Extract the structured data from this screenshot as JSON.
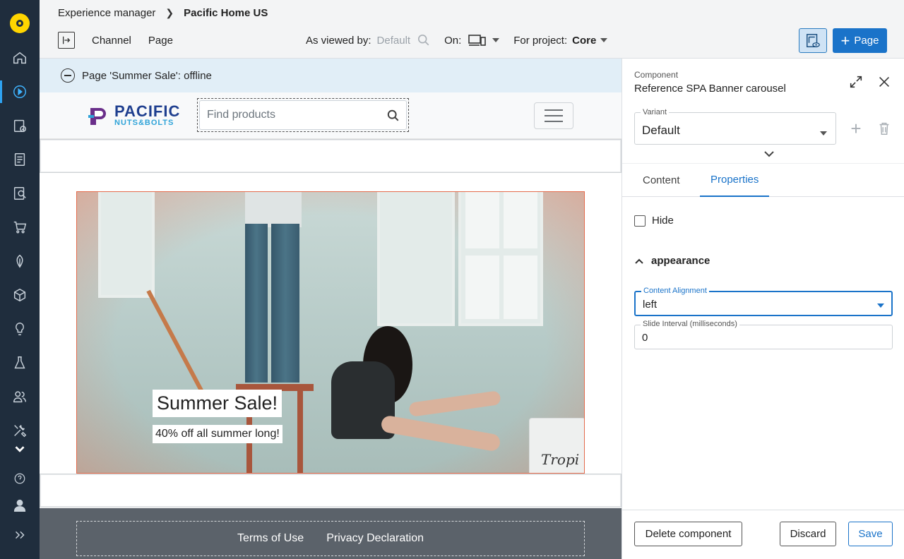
{
  "breadcrumb": {
    "root": "Experience manager",
    "current": "Pacific Home US"
  },
  "toolbar": {
    "channel_label": "Channel",
    "page_label": "Page",
    "viewed_by_label": "As viewed by:",
    "viewed_by_value": "Default",
    "on_label": "On:",
    "project_label": "For project:",
    "project_value": "Core",
    "new_page_label": "Page"
  },
  "sidebar": {
    "icons": [
      "home-icon",
      "channels-icon",
      "projects-icon",
      "content-icon",
      "search-content-icon",
      "cart-icon",
      "leaf-icon",
      "box-icon",
      "lightbulb-icon",
      "flask-icon",
      "users-icon",
      "tools-icon",
      "chevron-down-icon",
      "help-icon",
      "user-icon",
      "expand-icon"
    ]
  },
  "canvas": {
    "offline_notice": "Page 'Summer Sale': offline",
    "brand_line1": "PACIFIC",
    "brand_line2": "NUTS&BOLTS",
    "search_placeholder": "Find products",
    "banner_title": "Summer Sale!",
    "banner_subtitle": "40% off all summer long!",
    "bucket_text": "Tropi",
    "footer_links": [
      "Terms of Use",
      "Privacy Declaration"
    ]
  },
  "panel": {
    "component_caption": "Component",
    "component_title": "Reference SPA Banner carousel",
    "variant_label": "Variant",
    "variant_value": "Default",
    "tabs": [
      "Content",
      "Properties"
    ],
    "active_tab": "Properties",
    "hide_label": "Hide",
    "section_title": "appearance",
    "alignment_label": "Content Alignment",
    "alignment_value": "left",
    "interval_label": "Slide Interval (milliseconds)",
    "interval_value": "0",
    "delete_label": "Delete component",
    "discard_label": "Discard",
    "save_label": "Save"
  },
  "colors": {
    "accent": "#1a73c9",
    "rail": "#1f2d3d",
    "logo": "#ffd500",
    "footer": "#5b626a"
  }
}
